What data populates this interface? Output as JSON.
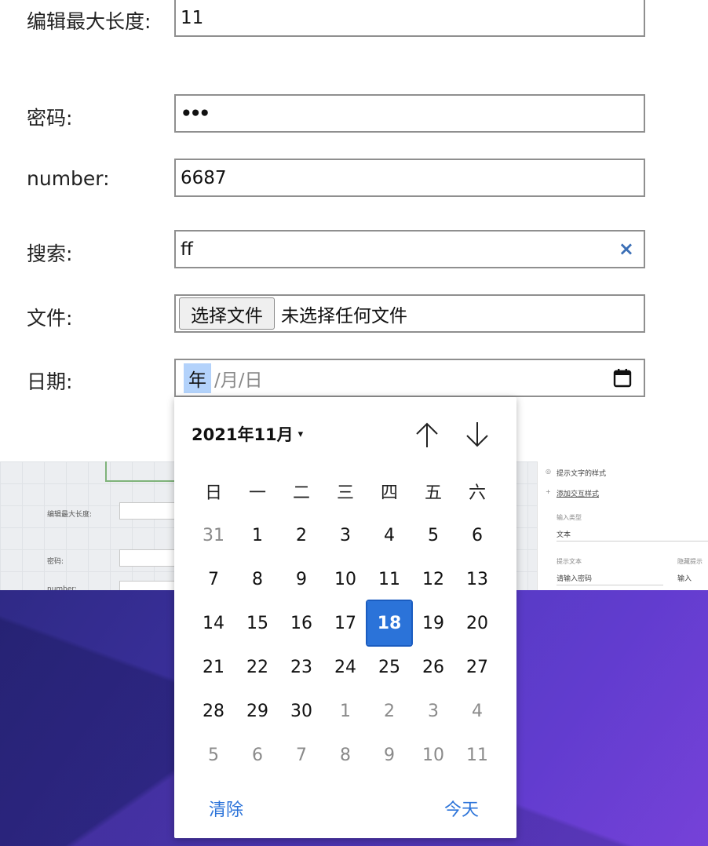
{
  "form": {
    "rows": {
      "maxlen": {
        "label": "编辑最大长度:",
        "value": "11"
      },
      "password": {
        "label": "密码:",
        "value": "•••"
      },
      "number": {
        "label": "number:",
        "value": "6687"
      },
      "search": {
        "label": "搜索:",
        "value": "ff",
        "clear_icon": "×"
      },
      "file": {
        "label": "文件:",
        "button": "选择文件",
        "status": "未选择任何文件"
      },
      "date": {
        "label": "日期:",
        "year_seg": "年",
        "rest": "/月/日"
      }
    }
  },
  "datepicker": {
    "month_title": "2021年11月",
    "caret": "▾",
    "weekdays": [
      "日",
      "一",
      "二",
      "三",
      "四",
      "五",
      "六"
    ],
    "weeks": [
      [
        "31",
        "1",
        "2",
        "3",
        "4",
        "5",
        "6"
      ],
      [
        "7",
        "8",
        "9",
        "10",
        "11",
        "12",
        "13"
      ],
      [
        "14",
        "15",
        "16",
        "17",
        "18",
        "19",
        "20"
      ],
      [
        "21",
        "22",
        "23",
        "24",
        "25",
        "26",
        "27"
      ],
      [
        "28",
        "29",
        "30",
        "1",
        "2",
        "3",
        "4"
      ],
      [
        "5",
        "6",
        "7",
        "8",
        "9",
        "10",
        "11"
      ]
    ],
    "selected_day": "18",
    "clear_label": "清除",
    "today_label": "今天",
    "accent_color": "#2b73d9"
  },
  "background_app": {
    "labels": {
      "maxlen": "编辑最大长度:",
      "password": "密码:",
      "number": "number:"
    },
    "panel": {
      "hint_style": "提示文字的样式",
      "add_interaction": "添加交互样式",
      "input_type_label": "输入类型",
      "input_type_value": "文本",
      "hint_text_label": "提示文本",
      "hint_text_value": "请输入密码",
      "hidden_hint_label": "隐藏提示",
      "hidden_hint_value": "输入"
    }
  }
}
